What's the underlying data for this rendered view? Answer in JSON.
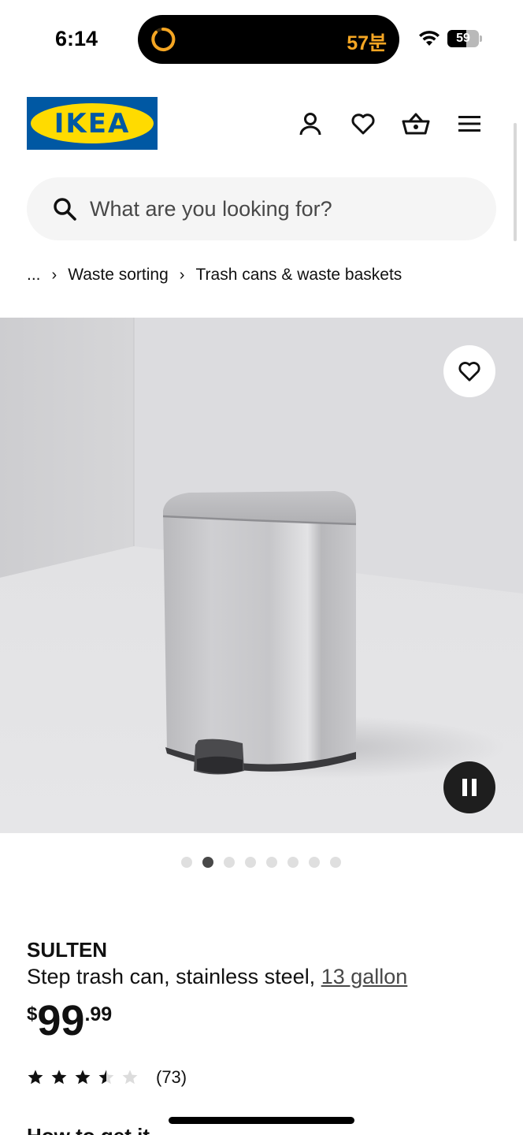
{
  "status_bar": {
    "time": "6:14",
    "live_activity": "57분",
    "battery_level": "59",
    "battery_fraction": 0.59
  },
  "header": {
    "logo_text": "IKEA",
    "brand_colors": {
      "blue": "#0058a3",
      "yellow": "#ffdb00"
    },
    "icons": [
      "account-icon",
      "heart-icon",
      "basket-icon",
      "menu-icon"
    ]
  },
  "search": {
    "placeholder": "What are you looking for?",
    "value": ""
  },
  "breadcrumb": {
    "items": [
      "...",
      "Waste sorting",
      "Trash cans & waste baskets"
    ]
  },
  "gallery": {
    "image_count": 8,
    "active_index": 1,
    "controls": [
      "favorite-icon",
      "pause-icon"
    ]
  },
  "product": {
    "name": "SULTEN",
    "description": "Step trash can, stainless steel,",
    "size_link": "13 gallon",
    "price": {
      "currency": "$",
      "whole": "99",
      "decimals": ".99"
    },
    "rating": {
      "stars": 3.5,
      "max": 5,
      "count": "(73)"
    },
    "next_section_partial": "How to get it"
  }
}
